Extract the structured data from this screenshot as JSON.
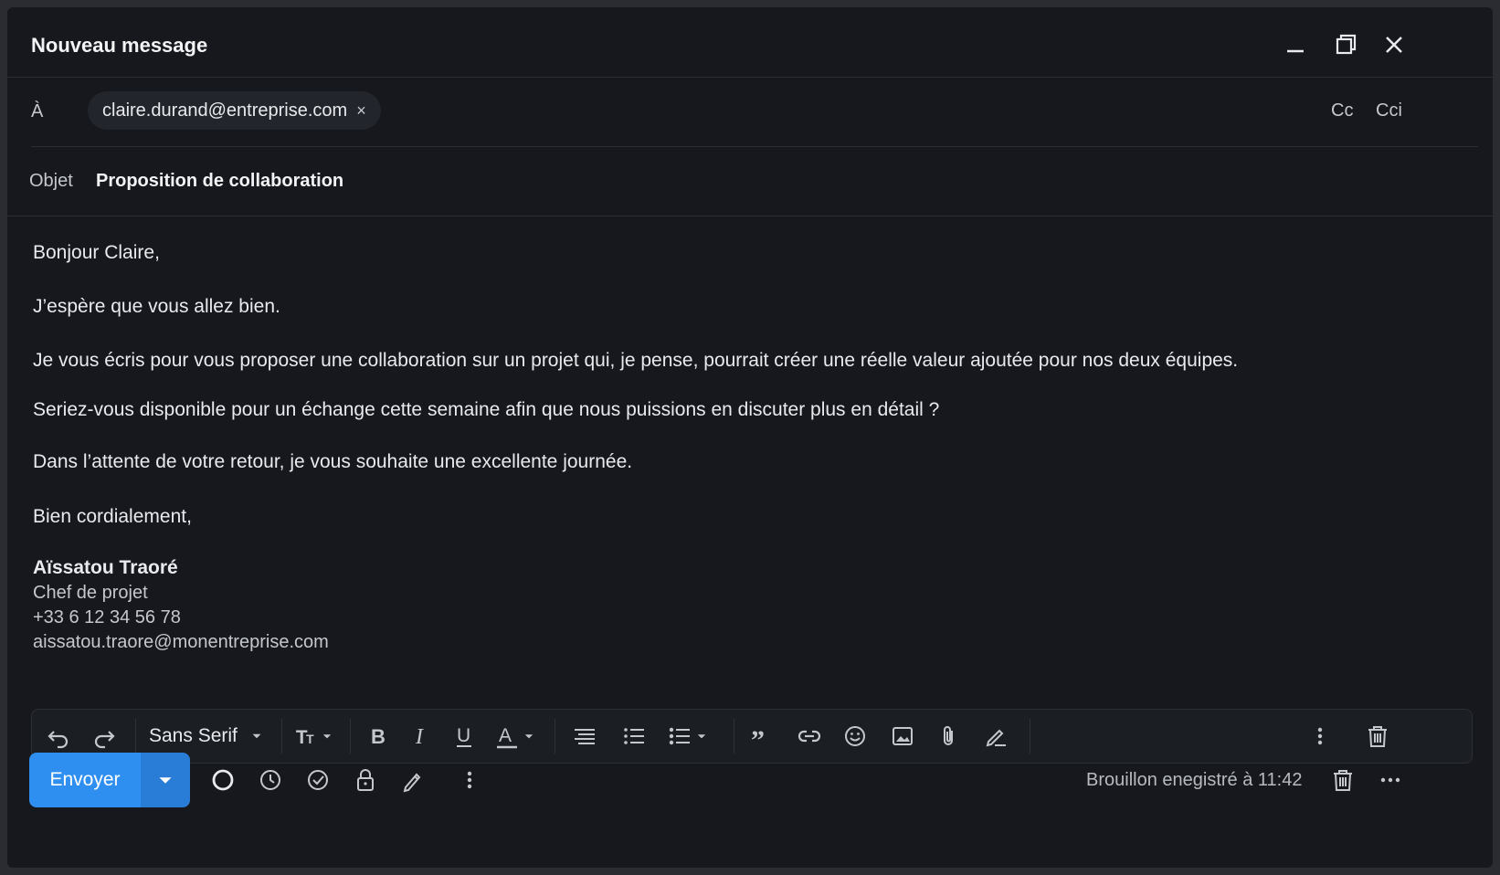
{
  "window": {
    "title": "Nouveau message",
    "controls": {
      "minimize_icon": "minimize-icon",
      "maximize_icon": "restore-icon",
      "close_icon": "close-icon"
    }
  },
  "recipients": {
    "to_label": "À",
    "to_chip": "claire.durand@entreprise.com",
    "remove_symbol": "×",
    "cc_label": "Cc",
    "bcc_label": "Cci"
  },
  "subject": {
    "label": "Objet",
    "value": "Proposition de collaboration"
  },
  "body": {
    "greeting": "Bonjour Claire,",
    "line1": "J’espère que vous allez bien.",
    "line2": "Je vous écris pour vous proposer une collaboration sur un projet qui, je pense, pourrait créer une réelle valeur ajoutée pour nos deux équipes.",
    "line3": "Seriez-vous disponible pour un échange cette semaine afin que nous puissions en discuter plus en détail ?",
    "line4": "Dans l’attente de votre retour, je vous souhaite une excellente journée.",
    "closing": "Bien cordialement,",
    "signature": {
      "name": "Aïssatou Traoré",
      "role": "Chef de projet",
      "phone": "+33 6 12 34 56 78",
      "email": "aissatou.traore@monentreprise.com"
    }
  },
  "toolbar": {
    "font_family": "Sans Serif"
  },
  "footer": {
    "send_label": "Envoyer",
    "draft_status": "Brouillon enegistré à 11:42"
  },
  "colors": {
    "accent": "#2f8ff0",
    "background": "#16181d",
    "text": "#e8eaed"
  }
}
